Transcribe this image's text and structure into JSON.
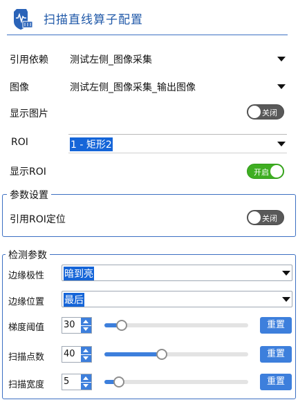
{
  "header": {
    "title": "扫描直线算子配置"
  },
  "fields": {
    "ref_label": "引用依赖",
    "ref_value": "测试左侧_图像采集",
    "image_label": "图像",
    "image_value": "测试左侧_图像采集_输出图像",
    "show_image_label": "显示图片",
    "show_image_state": "关闭",
    "roi_label": "ROI",
    "roi_value": "1 - 矩形2",
    "show_roi_label": "显示ROI",
    "show_roi_state": "开启"
  },
  "param_group": {
    "legend": "参数设置",
    "roi_locate_label": "引用ROI定位",
    "roi_locate_state": "关闭"
  },
  "detect_group": {
    "legend": "检测参数",
    "polarity_label": "边缘极性",
    "polarity_value": "暗到亮",
    "position_label": "边缘位置",
    "position_value": "最后",
    "rows": [
      {
        "label": "梯度阈值",
        "value": "30",
        "level": 0.12,
        "reset": "重置"
      },
      {
        "label": "扫描点数",
        "value": "40",
        "level": 0.4,
        "reset": "重置"
      },
      {
        "label": "扫描宽度",
        "value": "5",
        "level": 0.1,
        "reset": "重置"
      }
    ]
  },
  "colors": {
    "accent": "#3d7fdc",
    "title": "#1f58a8",
    "toggle_on": "#3fae22",
    "toggle_off": "#595959"
  },
  "icons": {
    "header": "scan-shield-icon"
  }
}
